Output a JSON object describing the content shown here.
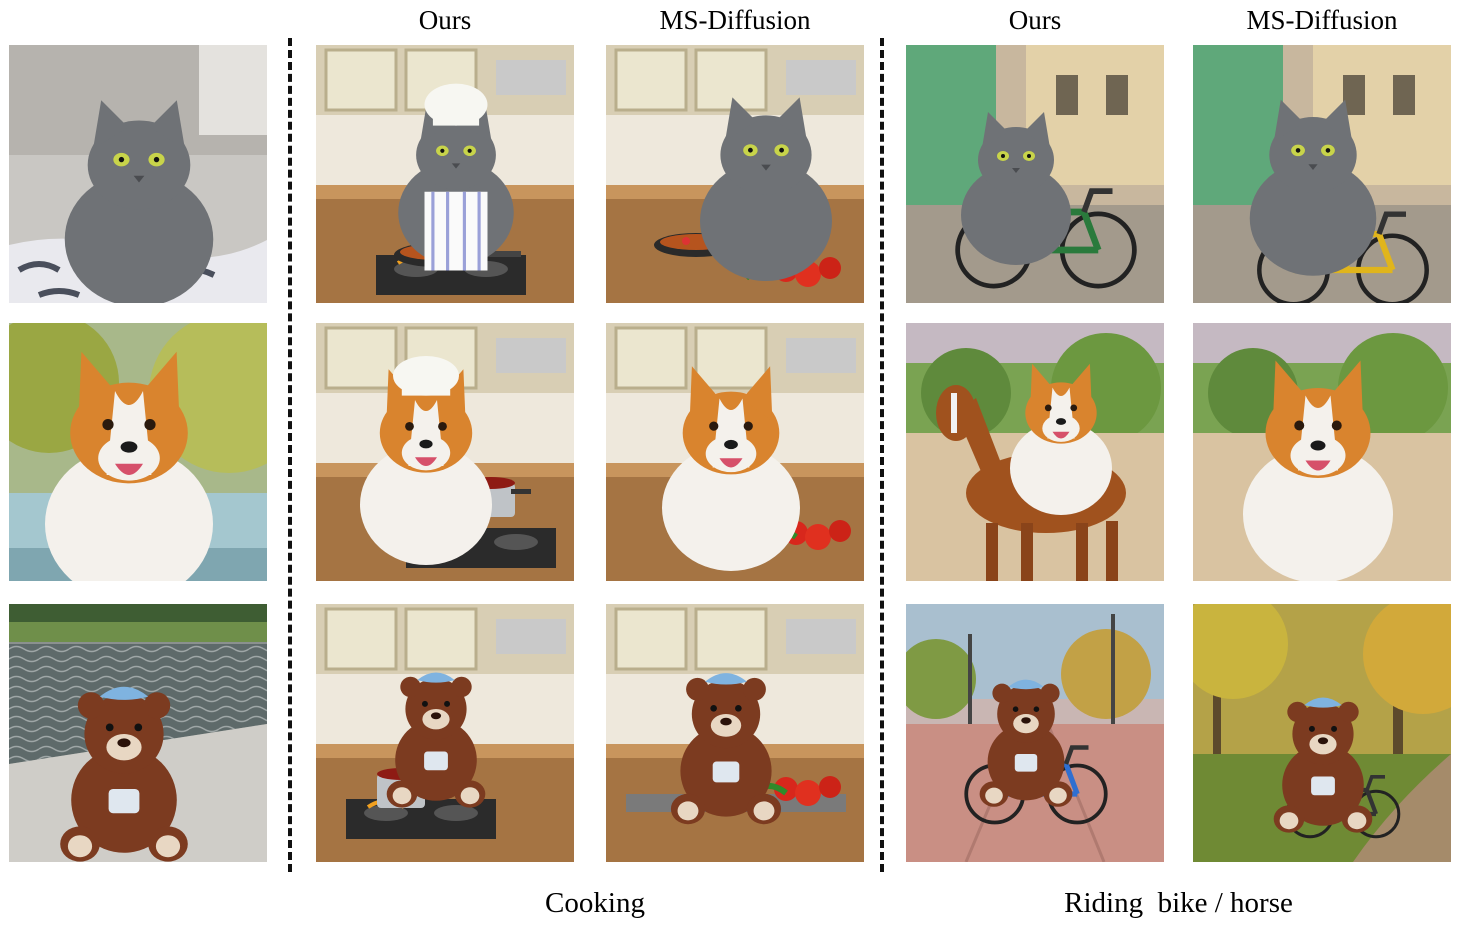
{
  "headers": [
    "Ours",
    "MS-Diffusion",
    "Ours",
    "MS-Diffusion"
  ],
  "groups": [
    "Cooking",
    "Riding  bike / horse"
  ],
  "colors": {
    "cat": "#6f7276",
    "cat_dark": "#4a4c50",
    "dog_orange": "#d9842e",
    "dog_white": "#f4f1ec",
    "bear": "#7c3b20",
    "bear_light": "#e8d7c3",
    "hat_blue": "#7fb3e0",
    "chef_white": "#f7f7f2",
    "pan": "#2a2a2a",
    "flame": "#f0a020"
  },
  "rows": [
    {
      "subject": "cat",
      "cells": [
        {
          "icon": "cat-photo-icon",
          "scene": "bed"
        },
        {
          "icon": "cat-chef-cooking-icon",
          "scene": "kitchen"
        },
        {
          "icon": "cat-cooking-icon",
          "scene": "kitchen"
        },
        {
          "icon": "cat-riding-bike-icon",
          "scene": "street"
        },
        {
          "icon": "cat-riding-bike-icon",
          "scene": "street"
        }
      ]
    },
    {
      "subject": "dog",
      "cells": [
        {
          "icon": "dog-photo-icon",
          "scene": "park"
        },
        {
          "icon": "dog-chef-cooking-icon",
          "scene": "kitchen"
        },
        {
          "icon": "dog-cooking-icon",
          "scene": "kitchen"
        },
        {
          "icon": "dog-riding-horse-icon",
          "scene": "field"
        },
        {
          "icon": "dog-running-icon",
          "scene": "field"
        }
      ]
    },
    {
      "subject": "teddy-bear",
      "cells": [
        {
          "icon": "teddy-bear-photo-icon",
          "scene": "riverside"
        },
        {
          "icon": "teddy-bear-cooking-icon",
          "scene": "kitchen"
        },
        {
          "icon": "teddy-bear-cooking-icon",
          "scene": "kitchen"
        },
        {
          "icon": "teddy-bear-riding-bike-icon",
          "scene": "road"
        },
        {
          "icon": "teddy-bear-riding-bike-icon",
          "scene": "park"
        }
      ]
    }
  ]
}
